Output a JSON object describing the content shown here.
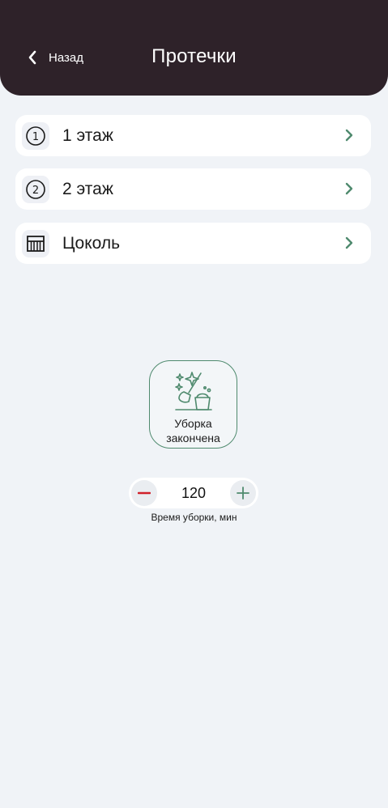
{
  "header": {
    "back_label": "Назад",
    "title": "Протечки"
  },
  "floors": [
    {
      "label": "1 этаж",
      "icon": "circled-one-icon"
    },
    {
      "label": "2 этаж",
      "icon": "circled-two-icon"
    },
    {
      "label": "Цоколь",
      "icon": "basement-icon"
    }
  ],
  "cleaning": {
    "button_line1": "Уборка",
    "button_line2": "закончена",
    "duration_value": "120",
    "duration_caption": "Время уборки, мин"
  },
  "colors": {
    "header_bg": "#2e2229",
    "accent_green": "#4f8a6e",
    "minus_red": "#d0202a",
    "page_bg": "#f0f3f7"
  }
}
